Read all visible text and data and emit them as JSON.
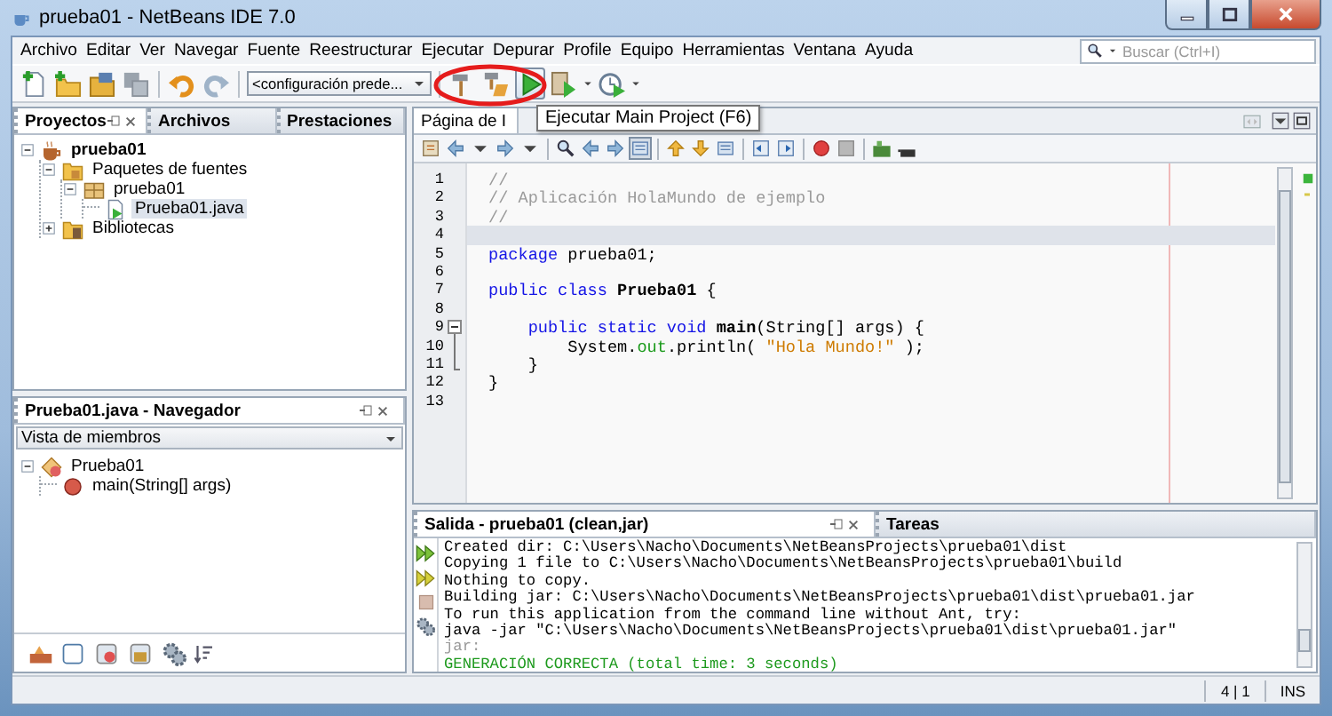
{
  "window": {
    "title": "prueba01 - NetBeans IDE 7.0"
  },
  "menu": [
    "Archivo",
    "Editar",
    "Ver",
    "Navegar",
    "Fuente",
    "Reestructurar",
    "Ejecutar",
    "Depurar",
    "Profile",
    "Equipo",
    "Herramientas",
    "Ventana",
    "Ayuda"
  ],
  "search": {
    "placeholder": "Buscar (Ctrl+I)"
  },
  "toolbar": {
    "configuration": "<configuración prede..."
  },
  "tooltip": {
    "text": "Ejecutar Main Project (F6)"
  },
  "projects_panel": {
    "tabs": [
      {
        "label": "Proyectos",
        "selected": true
      },
      {
        "label": "Archivos",
        "selected": false
      },
      {
        "label": "Prestaciones",
        "selected": false
      }
    ],
    "tree": [
      {
        "label": "prueba01",
        "kind": "project",
        "expanded": true,
        "selected": false,
        "children": [
          {
            "label": "Paquetes de fuentes",
            "kind": "folder",
            "expanded": true,
            "selected": false,
            "children": [
              {
                "label": "prueba01",
                "kind": "package",
                "expanded": true,
                "selected": false,
                "children": [
                  {
                    "label": "Prueba01.java",
                    "kind": "java",
                    "selected": true
                  }
                ]
              }
            ]
          },
          {
            "label": "Bibliotecas",
            "kind": "library",
            "expanded": false,
            "selected": false
          }
        ]
      }
    ]
  },
  "navigator": {
    "title": "Prueba01.java - Navegador",
    "view": "Vista de miembros",
    "tree": [
      {
        "label": "Prueba01",
        "kind": "class",
        "expanded": true,
        "selected": false,
        "children": [
          {
            "label": "main(String[] args)",
            "kind": "method",
            "selected": false
          }
        ]
      }
    ]
  },
  "editor": {
    "tabs": [
      {
        "label": "Página de I",
        "selected": true
      }
    ],
    "lines": [
      {
        "number": "1",
        "current": false,
        "tokens": [
          {
            "kind": "comment",
            "text": "//"
          }
        ]
      },
      {
        "number": "2",
        "current": false,
        "tokens": [
          {
            "kind": "comment",
            "text": "// Aplicación HolaMundo de ejemplo"
          }
        ]
      },
      {
        "number": "3",
        "current": false,
        "tokens": [
          {
            "kind": "comment",
            "text": "//"
          }
        ]
      },
      {
        "number": "4",
        "current": true
      },
      {
        "number": "5",
        "current": false,
        "tokens": [
          {
            "kind": "keyword",
            "text": "package"
          },
          {
            "kind": "plain",
            "text": " prueba01;"
          }
        ]
      },
      {
        "number": "6",
        "current": false
      },
      {
        "number": "7",
        "current": false,
        "tokens": [
          {
            "kind": "keyword",
            "text": "public class "
          },
          {
            "kind": "name",
            "text": "Prueba01"
          },
          {
            "kind": "plain",
            "text": " {"
          }
        ]
      },
      {
        "number": "8",
        "current": false
      },
      {
        "number": "9",
        "current": false,
        "expanded": true,
        "tokens": [
          {
            "kind": "keyword",
            "text": "    public static void "
          },
          {
            "kind": "name",
            "text": "main"
          },
          {
            "kind": "plain",
            "text": "(String[] args) {"
          }
        ]
      },
      {
        "number": "10",
        "current": false,
        "tokens": [
          {
            "kind": "plain",
            "text": "        System."
          },
          {
            "kind": "field",
            "text": "out"
          },
          {
            "kind": "plain",
            "text": ".println( "
          },
          {
            "kind": "string",
            "text": "\"Hola Mundo!\""
          },
          {
            "kind": "plain",
            "text": " );"
          }
        ]
      },
      {
        "number": "11",
        "current": false,
        "tokens": [
          {
            "kind": "plain",
            "text": "    }"
          }
        ]
      },
      {
        "number": "12",
        "current": false,
        "tokens": [
          {
            "kind": "plain",
            "text": "}"
          }
        ]
      },
      {
        "number": "13",
        "current": false
      }
    ]
  },
  "output": {
    "tabs": [
      {
        "label": "Salida - prueba01 (clean,jar)",
        "selected": true
      },
      {
        "label": "Tareas",
        "selected": false
      }
    ],
    "lines": [
      {
        "kind": "plain",
        "text": "Created dir: C:\\Users\\Nacho\\Documents\\NetBeansProjects\\prueba01\\dist"
      },
      {
        "kind": "plain",
        "text": "Copying 1 file to C:\\Users\\Nacho\\Documents\\NetBeansProjects\\prueba01\\build"
      },
      {
        "kind": "plain",
        "text": "Nothing to copy."
      },
      {
        "kind": "plain",
        "text": "Building jar: C:\\Users\\Nacho\\Documents\\NetBeansProjects\\prueba01\\dist\\prueba01.jar"
      },
      {
        "kind": "plain",
        "text": "To run this application from the command line without Ant, try:"
      },
      {
        "kind": "plain",
        "text": "java -jar \"C:\\Users\\Nacho\\Documents\\NetBeansProjects\\prueba01\\dist\\prueba01.jar\""
      },
      {
        "kind": "dim",
        "text": "jar:"
      },
      {
        "kind": "success",
        "text": "GENERACIÓN CORRECTA (total time: 3 seconds)"
      }
    ]
  },
  "status_bar": {
    "position": "4 | 1",
    "mode": "INS"
  }
}
